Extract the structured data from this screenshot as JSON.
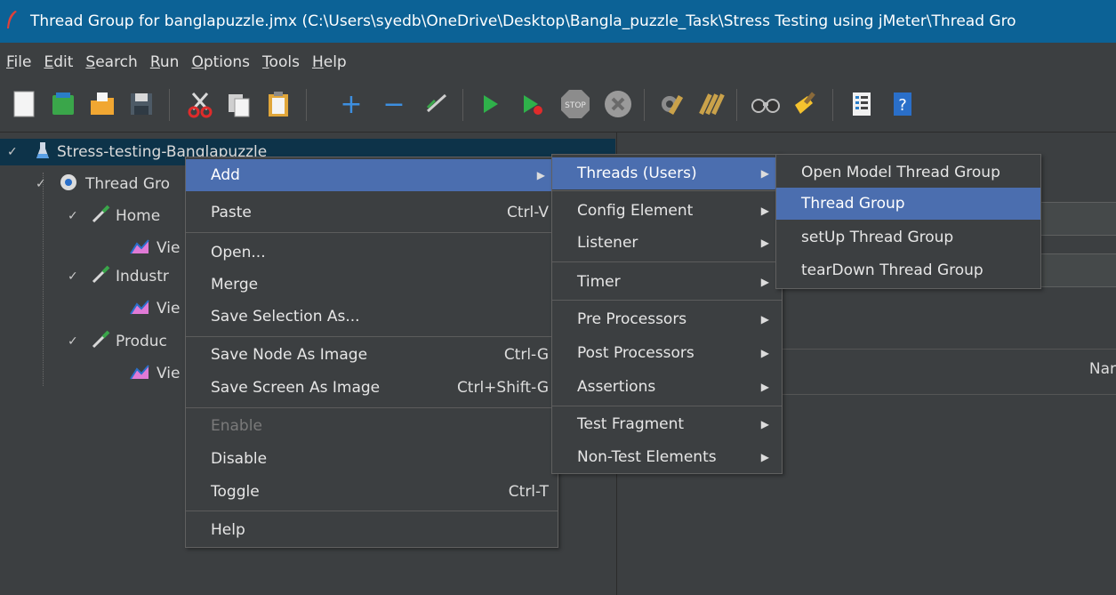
{
  "window": {
    "title": "Thread Group for banglapuzzle.jmx (C:\\Users\\syedb\\OneDrive\\Desktop\\Bangla_puzzle_Task\\Stress Testing using jMeter\\Thread Gro"
  },
  "menubar": {
    "items": [
      {
        "key": "F",
        "rest": "ile"
      },
      {
        "key": "E",
        "rest": "dit"
      },
      {
        "key": "S",
        "rest": "earch"
      },
      {
        "key": "R",
        "rest": "un"
      },
      {
        "key": "O",
        "rest": "ptions"
      },
      {
        "key": "T",
        "rest": "ools"
      },
      {
        "key": "H",
        "rest": "elp"
      }
    ]
  },
  "toolbar": {
    "icons": [
      "new-icon",
      "templates-icon",
      "open-icon",
      "save-icon",
      "cut-icon",
      "copy-icon",
      "paste-icon",
      "expand-icon",
      "collapse-icon",
      "toggle-icon",
      "start-icon",
      "start-no-pauses-icon",
      "stop-icon",
      "shutdown-icon",
      "clear-icon",
      "clear-all-icon",
      "search-icon",
      "reset-search-icon",
      "function-helper-icon",
      "help-icon"
    ],
    "stop_label": "STOP"
  },
  "tree": {
    "root": "Stress-testing-Banglapuzzle",
    "thread_group": "Thread Gro",
    "samplers": [
      "Home",
      "Industr",
      "Produc"
    ],
    "listener_label": "Vie"
  },
  "right_panel": {
    "column_header": "Nar"
  },
  "context_menu": {
    "items": [
      {
        "label": "Add",
        "shortcut": "",
        "submenu": true,
        "highlighted": true
      },
      {
        "label": "Paste",
        "shortcut": "Ctrl-V"
      },
      {
        "label": "Open...",
        "shortcut": ""
      },
      {
        "label": "Merge",
        "shortcut": ""
      },
      {
        "label": "Save Selection As...",
        "shortcut": ""
      },
      {
        "label": "Save Node As Image",
        "shortcut": "Ctrl-G"
      },
      {
        "label": "Save Screen As Image",
        "shortcut": "Ctrl+Shift-G"
      },
      {
        "label": "Enable",
        "shortcut": "",
        "disabled": true
      },
      {
        "label": "Disable",
        "shortcut": ""
      },
      {
        "label": "Toggle",
        "shortcut": "Ctrl-T"
      },
      {
        "label": "Help",
        "shortcut": ""
      }
    ]
  },
  "add_submenu": {
    "items": [
      {
        "label": "Threads (Users)",
        "highlighted": true
      },
      {
        "label": "Config Element"
      },
      {
        "label": "Listener"
      },
      {
        "label": "Timer"
      },
      {
        "label": "Pre Processors"
      },
      {
        "label": "Post Processors"
      },
      {
        "label": "Assertions"
      },
      {
        "label": "Test Fragment"
      },
      {
        "label": "Non-Test Elements"
      }
    ]
  },
  "threads_submenu": {
    "items": [
      {
        "label": "Open Model Thread Group"
      },
      {
        "label": "Thread Group",
        "highlighted": true
      },
      {
        "label": "setUp Thread Group"
      },
      {
        "label": "tearDown Thread Group"
      }
    ]
  },
  "colors": {
    "titlebar": "#0c6296",
    "background": "#3c3f41",
    "highlight": "#4b6eaf",
    "tree_selection": "#0d3349"
  }
}
